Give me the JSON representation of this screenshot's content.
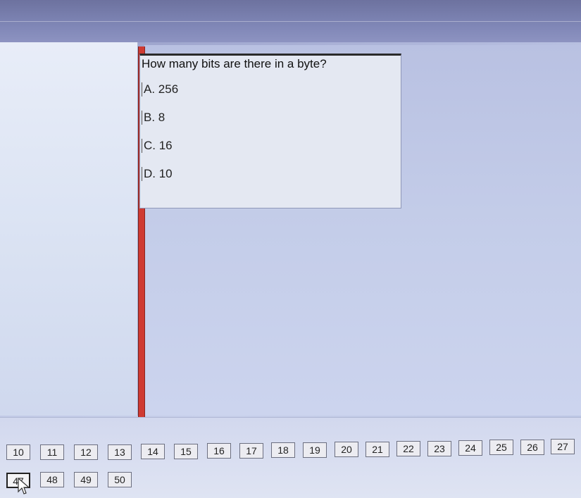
{
  "question": {
    "text": "How many bits are there in a byte?",
    "options": [
      {
        "label": "A. 256"
      },
      {
        "label": "B. 8"
      },
      {
        "label": "C. 16"
      },
      {
        "label": "D. 10"
      }
    ]
  },
  "navigation": {
    "row1": [
      "10",
      "11",
      "12",
      "13",
      "14",
      "15",
      "16",
      "17",
      "18",
      "19",
      "20",
      "21",
      "22",
      "23",
      "24",
      "25",
      "26",
      "27"
    ],
    "row2": [
      "47",
      "48",
      "49",
      "50"
    ],
    "current": "47"
  }
}
